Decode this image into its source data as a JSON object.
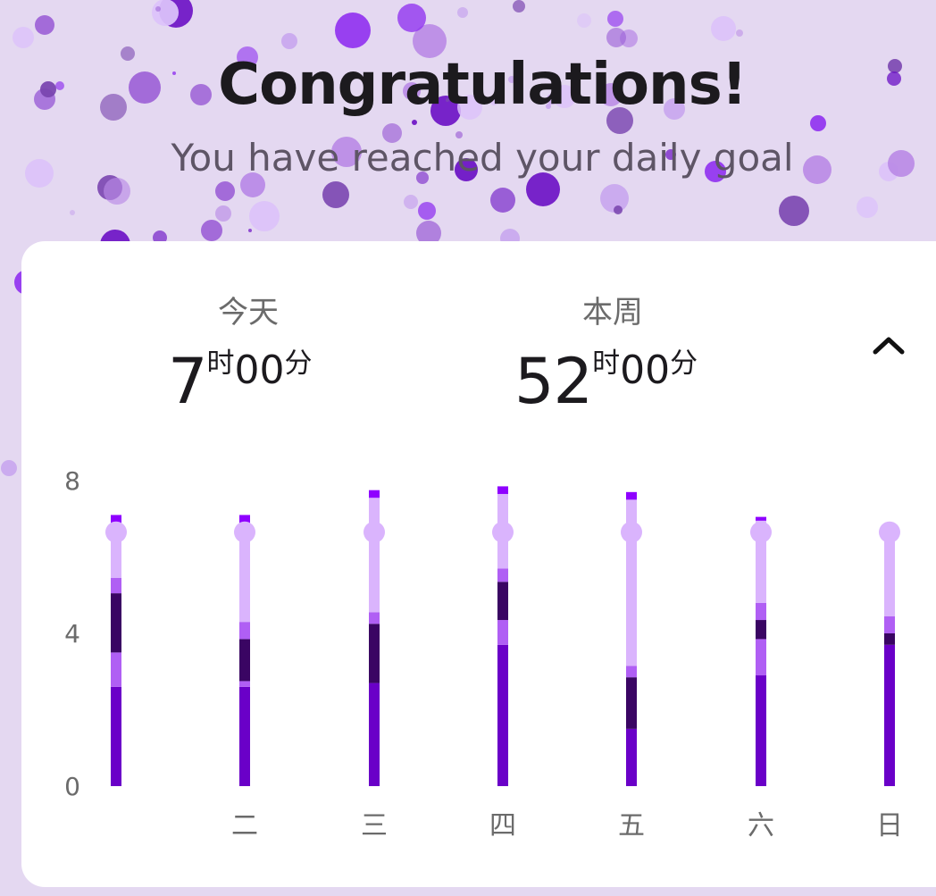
{
  "header": {
    "title": "Congratulations!",
    "subtitle": "You have reached your daily goal"
  },
  "summary": {
    "today": {
      "label": "今天",
      "hours": "7",
      "hour_unit": "时",
      "minutes": "00",
      "minute_unit": "分"
    },
    "week": {
      "label": "本周",
      "hours": "52",
      "hour_unit": "时",
      "minutes": "00",
      "minute_unit": "分"
    }
  },
  "collapse_icon": "chevron-up-icon",
  "colors": {
    "background": "#e4d8f1",
    "card": "#ffffff",
    "deep": "#6a00c8",
    "dark": "#3a0563",
    "mid": "#b05ff4",
    "light": "#dab4fd",
    "top": "#8f00ff",
    "goal_marker": "#dab4fd"
  },
  "chart_data": {
    "type": "bar",
    "stacked": true,
    "categories": [
      "",
      "二",
      "三",
      "四",
      "五",
      "六",
      "日"
    ],
    "y_ticks": [
      "0",
      "4",
      "8"
    ],
    "ylim": [
      0,
      8
    ],
    "goal": 6.65,
    "series": [
      {
        "color_key": "deep",
        "values": [
          2.6,
          2.6,
          2.7,
          3.7,
          1.5,
          2.9,
          3.7
        ]
      },
      {
        "color_key": "mid",
        "values": [
          0.9,
          0.15,
          0.0,
          0.65,
          0.0,
          0.95,
          0.0
        ]
      },
      {
        "color_key": "dark",
        "values": [
          1.55,
          1.1,
          1.55,
          1.0,
          1.35,
          0.5,
          0.3
        ]
      },
      {
        "color_key": "mid",
        "values": [
          0.4,
          0.45,
          0.3,
          0.35,
          0.3,
          0.45,
          0.45
        ]
      },
      {
        "color_key": "light",
        "values": [
          1.4,
          2.5,
          3.0,
          1.95,
          4.35,
          2.15,
          2.2
        ]
      },
      {
        "color_key": "top",
        "values": [
          0.25,
          0.3,
          0.2,
          0.2,
          0.2,
          0.1,
          0.2
        ]
      }
    ]
  }
}
